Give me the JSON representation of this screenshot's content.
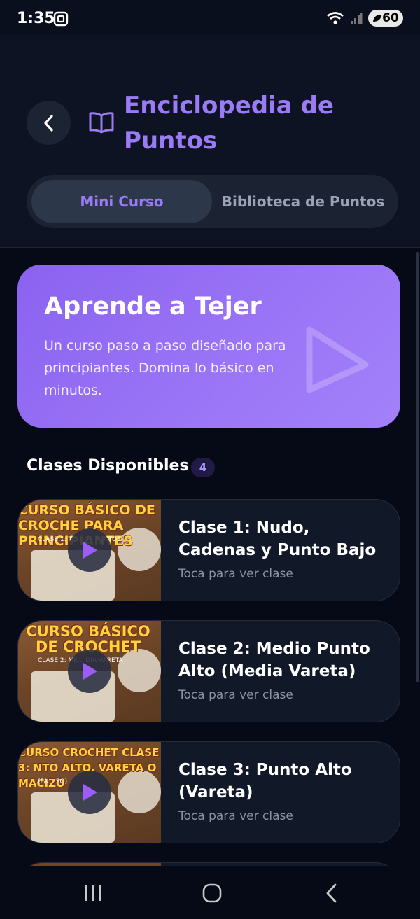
{
  "status_bar": {
    "time": "1:35",
    "battery": "60"
  },
  "header": {
    "title": "Enciclopedia de Puntos",
    "tabs": [
      {
        "label": "Mini Curso",
        "active": true
      },
      {
        "label": "Biblioteca de Puntos",
        "active": false
      }
    ]
  },
  "hero": {
    "title": "Aprende a Tejer",
    "description": "Un curso paso a paso diseñado para principiantes. Domina lo básico en minutos."
  },
  "section": {
    "title": "Clases Disponibles",
    "count": "4"
  },
  "classes": [
    {
      "title": "Clase 1: Nudo, Cadenas y Punto Bajo",
      "hint": "Toca para ver clase",
      "thumb_text": "CURSO BÁSICO DE CROCHE PARA PRINCIPIANTES",
      "thumb_sub": "CLASE 1: TE... OS PUNTOS"
    },
    {
      "title": "Clase 2: Medio Punto Alto (Media Vareta)",
      "hint": "Toca para ver clase",
      "thumb_text": "CURSO BÁSICO DE CROCHET",
      "thumb_sub": "CLASE 2: ME... DIA VARETA"
    },
    {
      "title": "Clase 3: Punto Alto (Vareta)",
      "hint": "Toca para ver clase",
      "thumb_text": "CURSO CROCHET CLASE 3: NTO ALTO, VARETA O MACIZO",
      "thumb_sub": "(PA... SO)"
    }
  ],
  "colors": {
    "accent": "#9b7bf5",
    "background": "#060a16",
    "card": "#111828"
  },
  "icons": {
    "back": "chevron-left-icon",
    "book": "open-book-icon",
    "play": "play-icon",
    "recents": "recents-icon",
    "home": "home-icon",
    "nav_back": "nav-back-icon"
  }
}
